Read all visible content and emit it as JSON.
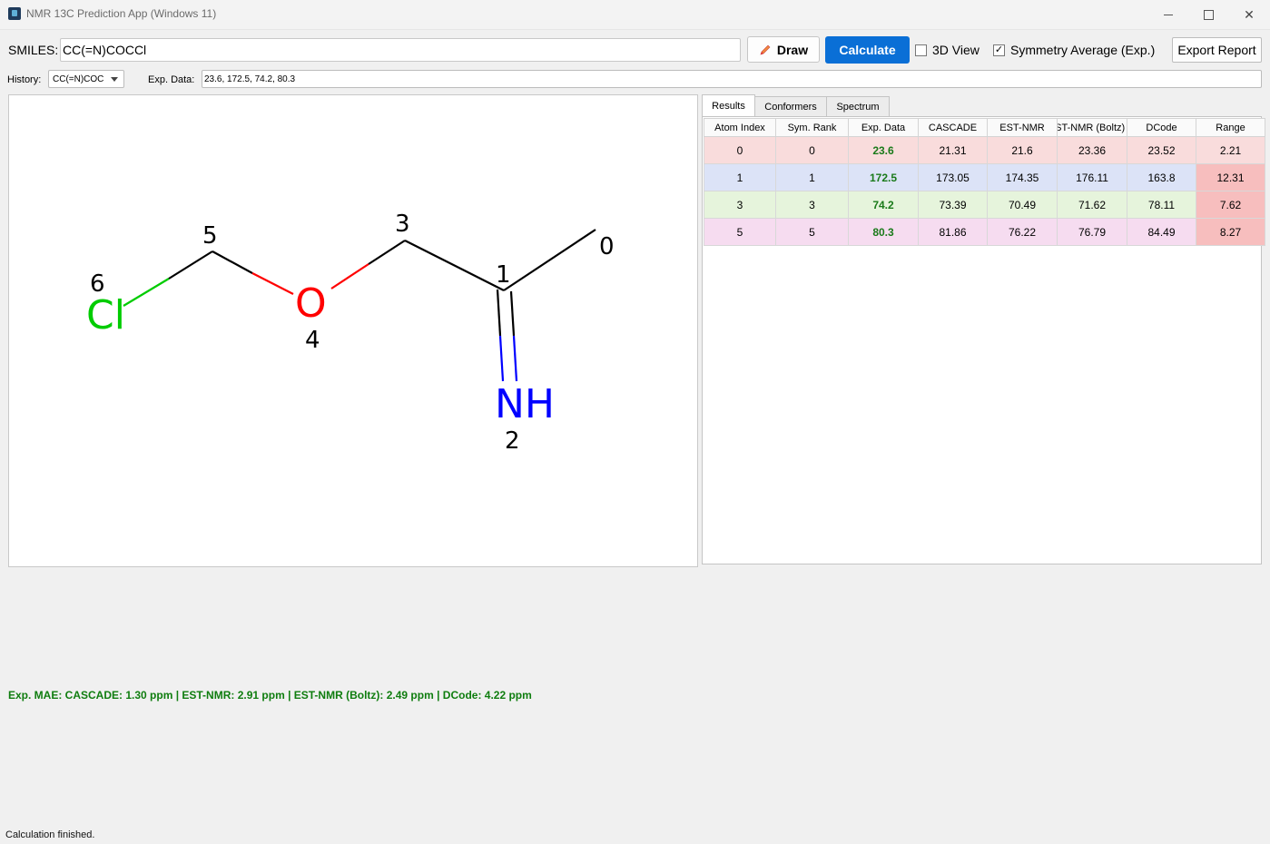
{
  "window": {
    "title": "NMR 13C Prediction App (Windows 11)"
  },
  "toolbar": {
    "smiles_label": "SMILES:",
    "smiles_value": "CC(=N)COCCl",
    "draw_label": "Draw",
    "calculate_label": "Calculate",
    "view3d_label": "3D View",
    "view3d_checked": false,
    "symmetry_label": "Symmetry Average (Exp.)",
    "symmetry_checked": true,
    "export_label": "Export Report"
  },
  "history": {
    "label": "History:",
    "selected": "CC(=N)COC"
  },
  "exp_data": {
    "label": "Exp. Data:",
    "value": "23.6, 172.5, 74.2, 80.3"
  },
  "molecule": {
    "atoms": [
      {
        "symbol": "Cl",
        "index_label": "6",
        "color": "#00cc00"
      },
      {
        "symbol": "O",
        "index_label": "4",
        "color": "#ff0000"
      },
      {
        "symbol": "NH",
        "index_label": "2",
        "color": "#0000ff"
      },
      {
        "symbol": "",
        "index_label": "5"
      },
      {
        "symbol": "",
        "index_label": "3"
      },
      {
        "symbol": "",
        "index_label": "1"
      },
      {
        "symbol": "",
        "index_label": "0"
      }
    ]
  },
  "tabs": [
    "Results",
    "Conformers",
    "Spectrum"
  ],
  "table": {
    "headers": [
      "Atom Index",
      "Sym. Rank",
      "Exp. Data",
      "CASCADE",
      "EST-NMR",
      "EST-NMR (Boltz)",
      "DCode",
      "Range"
    ],
    "rows": [
      {
        "cells": [
          "0",
          "0",
          "23.6",
          "21.31",
          "21.6",
          "23.36",
          "23.52",
          "2.21"
        ],
        "color": "#f9dcdc",
        "range_highlight": false
      },
      {
        "cells": [
          "1",
          "1",
          "172.5",
          "173.05",
          "174.35",
          "176.11",
          "163.8",
          "12.31"
        ],
        "color": "#dce3f7",
        "range_highlight": true
      },
      {
        "cells": [
          "3",
          "3",
          "74.2",
          "73.39",
          "70.49",
          "71.62",
          "78.11",
          "7.62"
        ],
        "color": "#e6f4dc",
        "range_highlight": true
      },
      {
        "cells": [
          "5",
          "5",
          "80.3",
          "81.86",
          "76.22",
          "76.79",
          "84.49",
          "8.27"
        ],
        "color": "#f6dcf0",
        "range_highlight": true
      }
    ]
  },
  "mae_text": "Exp. MAE: CASCADE: 1.30 ppm | EST-NMR: 2.91 ppm | EST-NMR (Boltz): 2.49 ppm | DCode: 4.22 ppm",
  "status": "Calculation finished."
}
